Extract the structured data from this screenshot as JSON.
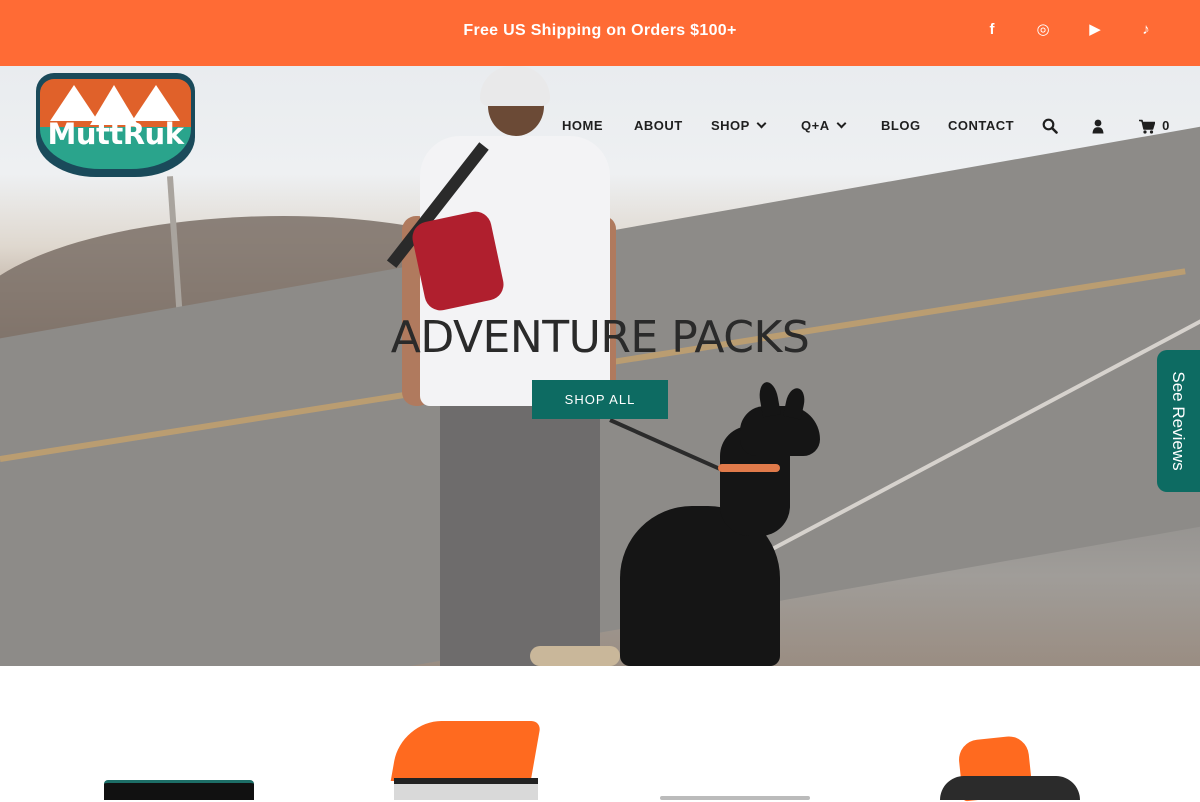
{
  "announcement": {
    "text": "Free US Shipping on Orders $100+"
  },
  "social": [
    {
      "name": "facebook-icon",
      "glyph": "f"
    },
    {
      "name": "instagram-icon",
      "glyph": "◎"
    },
    {
      "name": "youtube-icon",
      "glyph": "▶"
    },
    {
      "name": "tiktok-icon",
      "glyph": "♪"
    }
  ],
  "brand": {
    "logo_text": "MuttRuk",
    "colors": {
      "orange": "#ff6b35",
      "teal": "#0d6b62",
      "navy": "#1a4a5a",
      "green": "#2aa48c"
    }
  },
  "nav": {
    "items": [
      {
        "label": "HOME",
        "dropdown": false
      },
      {
        "label": "ABOUT",
        "dropdown": false
      },
      {
        "label": "SHOP",
        "dropdown": true
      },
      {
        "label": "Q+A",
        "dropdown": true
      },
      {
        "label": "BLOG",
        "dropdown": false
      },
      {
        "label": "CONTACT",
        "dropdown": false
      }
    ],
    "icons": {
      "search": "search-icon",
      "account": "user-icon",
      "cart": "cart-icon"
    },
    "cart_count": "0"
  },
  "hero": {
    "title": "ADVENTURE PACKS",
    "button_label": "SHOP ALL"
  },
  "reviews_tab": {
    "label": "See Reviews"
  }
}
